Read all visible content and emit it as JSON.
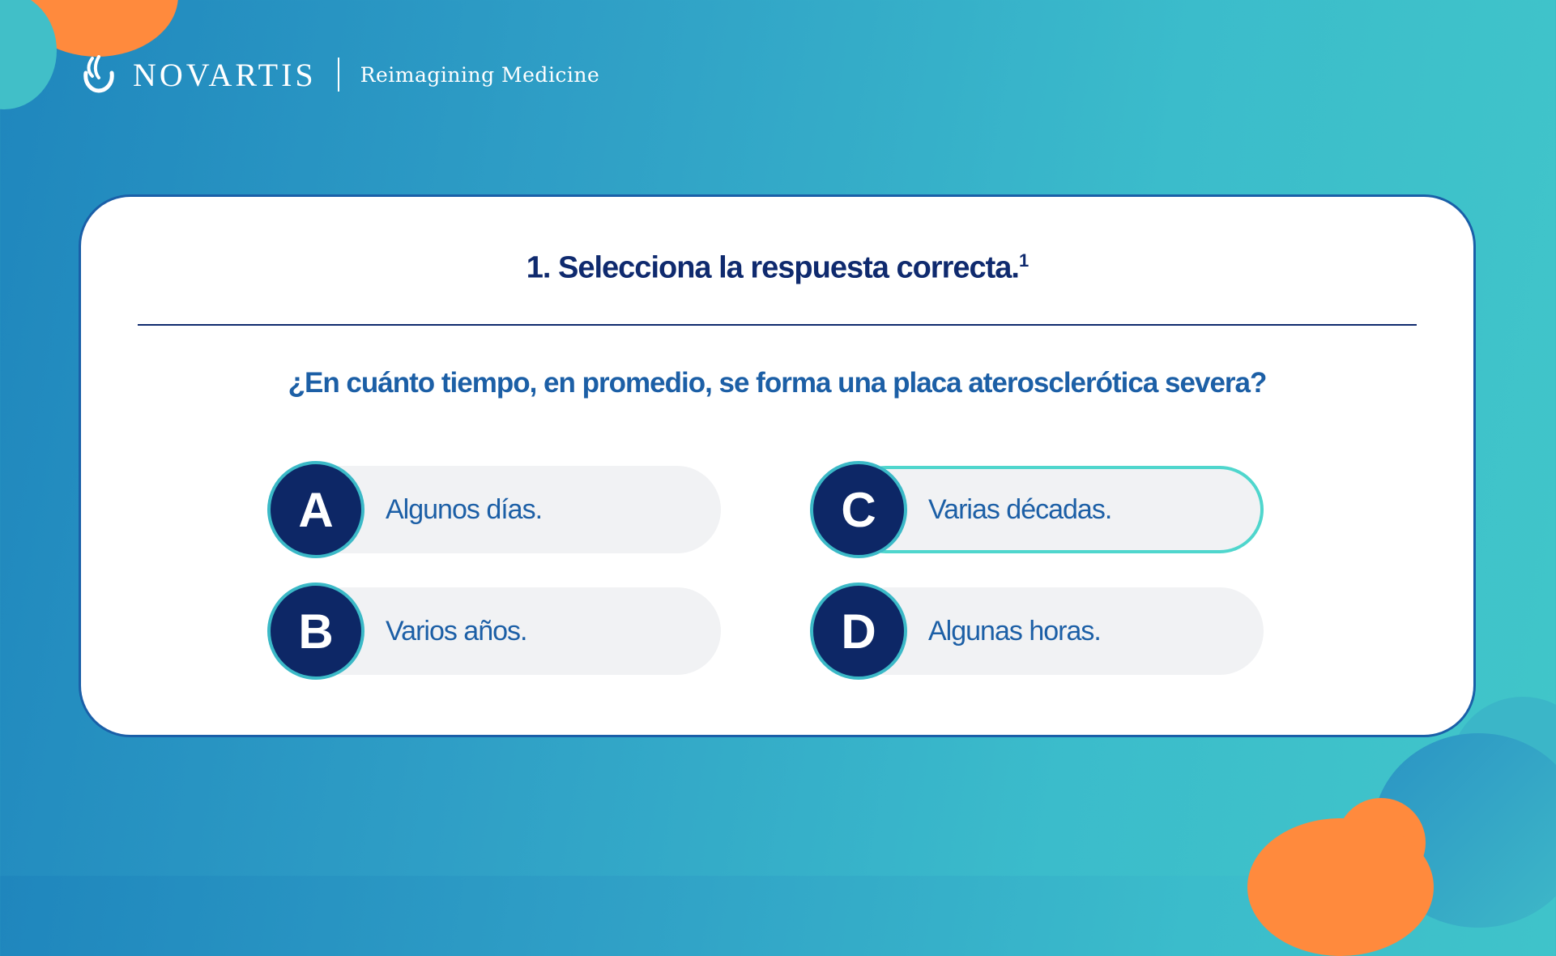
{
  "header": {
    "brand_name": "NOVARTIS",
    "tagline": "Reimagining Medicine"
  },
  "quiz": {
    "title": "1. Selecciona la respuesta correcta.",
    "title_superscript": "1",
    "question": "¿En cuánto tiempo, en promedio, se forma una placa aterosclerótica severa?",
    "options": [
      {
        "letter": "A",
        "text": "Algunos días.",
        "selected": false
      },
      {
        "letter": "B",
        "text": "Varios años.",
        "selected": false
      },
      {
        "letter": "C",
        "text": "Varias décadas.",
        "selected": true
      },
      {
        "letter": "D",
        "text": "Algunas horas.",
        "selected": false
      }
    ]
  },
  "colors": {
    "background_start": "#1f86bd",
    "background_end": "#41c6c9",
    "accent_orange": "#ff8a3d",
    "badge_navy": "#0d2766",
    "text_blue": "#1c5fa6",
    "selected_border": "#4fd6cd"
  },
  "icons": {
    "logo": "novartis-flame-icon"
  }
}
